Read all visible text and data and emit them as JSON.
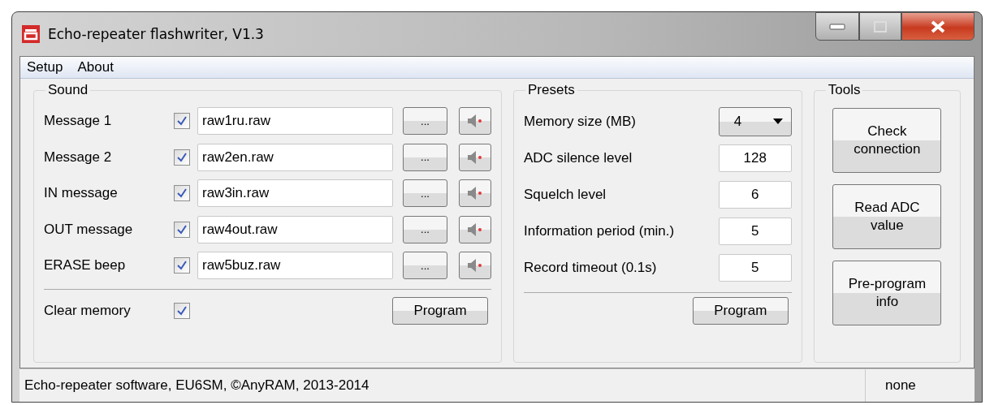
{
  "window": {
    "title": "Echo-repeater flashwriter, V1.3"
  },
  "menu": [
    "Setup",
    "About"
  ],
  "sound": {
    "title": "Sound",
    "rows": [
      {
        "label": "Message 1",
        "checked": true,
        "file": "raw1ru.raw",
        "browse": "..."
      },
      {
        "label": "Message 2",
        "checked": true,
        "file": "raw2en.raw",
        "browse": "..."
      },
      {
        "label": "IN message",
        "checked": true,
        "file": "raw3in.raw",
        "browse": "..."
      },
      {
        "label": "OUT message",
        "checked": true,
        "file": "raw4out.raw",
        "browse": "..."
      },
      {
        "label": "ERASE beep",
        "checked": true,
        "file": "raw5buz.raw",
        "browse": "..."
      }
    ],
    "clear_memory": {
      "label": "Clear memory",
      "checked": true
    },
    "program_button": "Program"
  },
  "presets": {
    "title": "Presets",
    "memory_size": {
      "label": "Memory size (MB)",
      "value": "4"
    },
    "fields": [
      {
        "label": "ADC silence level",
        "value": "128"
      },
      {
        "label": "Squelch level",
        "value": "6"
      },
      {
        "label": "Information period (min.)",
        "value": "5"
      },
      {
        "label": "Record timeout (0.1s)",
        "value": "5"
      }
    ],
    "program_button": "Program"
  },
  "tools": {
    "title": "Tools",
    "buttons": [
      "Check connection",
      "Read ADC value",
      "Pre-program info"
    ]
  },
  "status_bar": [
    "Echo-repeater software, EU6SM, ©AnyRAM, 2013-2014",
    "none"
  ]
}
